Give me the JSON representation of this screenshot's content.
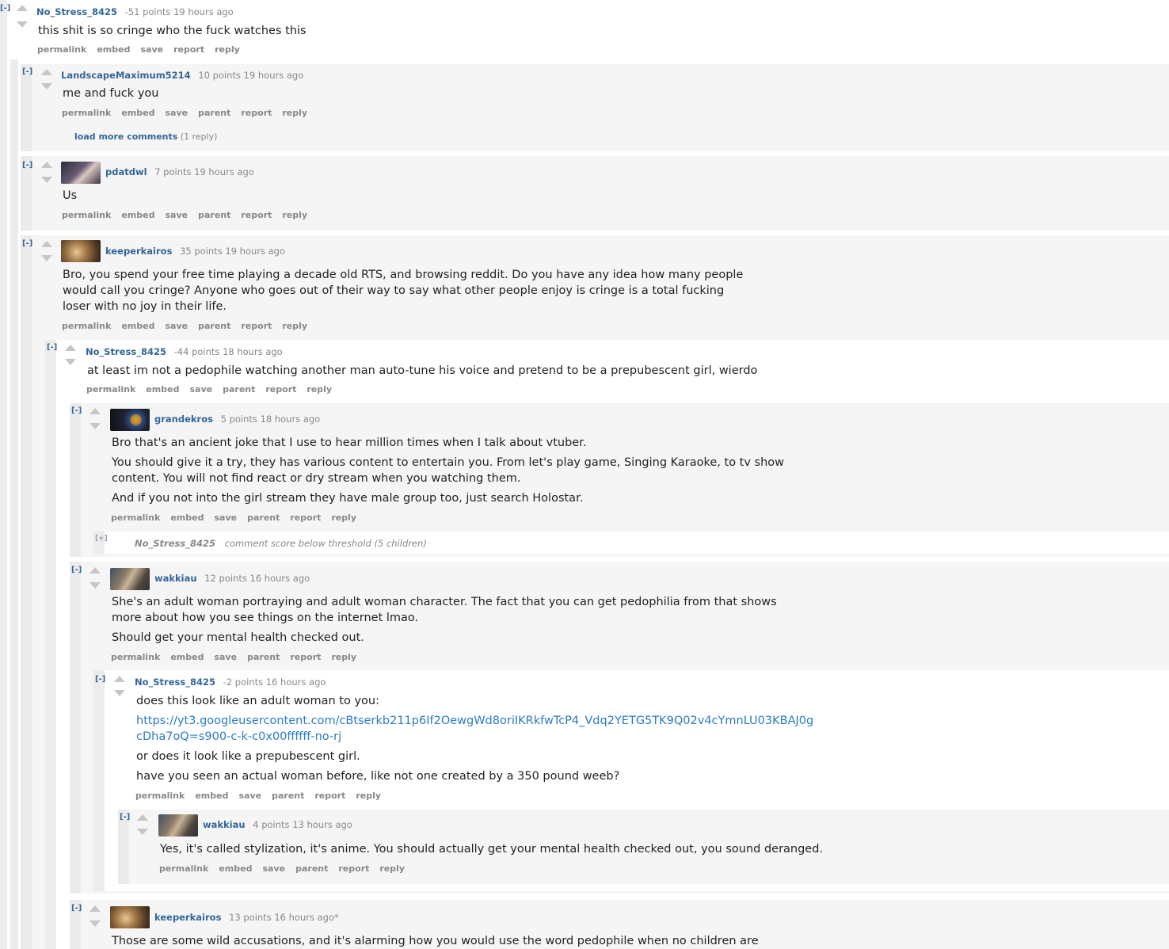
{
  "ui": {
    "toggle_open": "[-]",
    "toggle_closed": "[+]"
  },
  "actions": {
    "permalink": "permalink",
    "embed": "embed",
    "save": "save",
    "parent": "parent",
    "report": "report",
    "reply": "reply"
  },
  "comments": {
    "c1": {
      "author": "No_Stress_8425",
      "score": "-51 points",
      "time": "19 hours ago",
      "body": [
        "this shit is so cringe who the fuck watches this"
      ]
    },
    "c2": {
      "author": "LandscapeMaximum5214",
      "score": "10 points",
      "time": "19 hours ago",
      "body": [
        "me and fuck you"
      ],
      "load_more": "load more comments",
      "load_more_count": "(1 reply)"
    },
    "c3": {
      "author": "pdatdwl",
      "score": "7 points",
      "time": "19 hours ago",
      "body": [
        "Us"
      ]
    },
    "c4": {
      "author": "keeperkairos",
      "score": "35 points",
      "time": "19 hours ago",
      "body": [
        "Bro, you spend your free time playing a decade old RTS, and browsing reddit. Do you have any idea how many people",
        "would call you cringe? Anyone who goes out of their way to say what other people enjoy is cringe is a total fucking",
        "loser with no joy in their life."
      ]
    },
    "c5": {
      "author": "No_Stress_8425",
      "score": "-44 points",
      "time": "18 hours ago",
      "body": [
        "at least im not a pedophile watching another man auto-tune his voice and pretend to be a prepubescent girl, wierdo"
      ]
    },
    "c6": {
      "author": "grandekros",
      "score": "5 points",
      "time": "18 hours ago",
      "body": [
        "Bro that's an ancient joke that I use to hear million times when I talk about vtuber.",
        "You should give it a try, they has various content to entertain you. From let's play game, Singing Karaoke, to tv show",
        "content. You will not find react or dry stream when you watching them.",
        "And if you not into the girl stream they have male group too, just search Holostar."
      ]
    },
    "c6b": {
      "author": "No_Stress_8425",
      "note": "comment score below threshold",
      "children": "(5 children)"
    },
    "c7": {
      "author": "wakkiau",
      "score": "12 points",
      "time": "16 hours ago",
      "body": [
        "She's an adult woman portraying and adult woman character. The fact that you can get pedophilia from that shows",
        "more about how you see things on the internet lmao.",
        "Should get your mental health checked out."
      ]
    },
    "c8": {
      "author": "No_Stress_8425",
      "score": "-2 points",
      "time": "16 hours ago",
      "body": [
        "does this look like an adult woman to you:",
        "https://yt3.googleusercontent.com/cBtserkb211p6If2OewgWd8oriIKRkfwTcP4_Vdq2YETG5TK9Q02v4cYmnLU03KBAJ0g",
        "cDha7oQ=s900-c-k-c0x00ffffff-no-rj",
        "or does it look like a prepubescent girl.",
        "have you seen an actual woman before, like not one created by a 350 pound weeb?"
      ]
    },
    "c9": {
      "author": "wakkiau",
      "score": "4 points",
      "time": "13 hours ago",
      "body": [
        "Yes, it's called stylization, it's anime. You should actually get your mental health checked out, you sound deranged."
      ]
    },
    "c10": {
      "author": "keeperkairos",
      "score": "13 points",
      "time": "16 hours ago",
      "edited": "*",
      "body": [
        "Those are some wild accusations, and it's alarming how you would use the word pedophile when no children are"
      ]
    }
  },
  "colors": {
    "link": "#336699",
    "url": "#2a7bc4",
    "odd_bg": "#f5f5f5",
    "even_bg": "#ffffff",
    "rail": "#e6e6e6"
  }
}
